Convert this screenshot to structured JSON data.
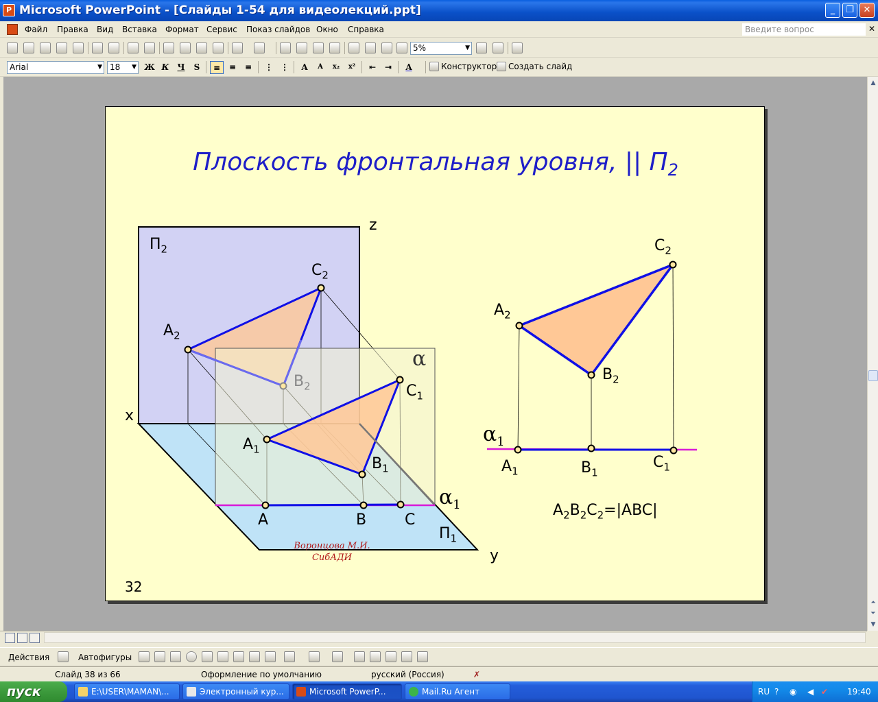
{
  "window": {
    "title": "Microsoft PowerPoint - [Слайды 1-54 для видеолекций.ppt]"
  },
  "menu": {
    "items": [
      "Файл",
      "Правка",
      "Вид",
      "Вставка",
      "Формат",
      "Сервис",
      "Показ слайдов",
      "Окно",
      "Справка"
    ],
    "help_placeholder": "Введите вопрос"
  },
  "toolbar": {
    "zoom": "5%",
    "font_name": "Arial",
    "font_size": "18",
    "designer": "Конструктор",
    "new_slide": "Создать слайд"
  },
  "slide": {
    "title": "Плоскость фронтальная уровня, || П",
    "title_sub": "2",
    "number": "32",
    "author_line1": "Воронцова М.И.",
    "author_line2": "СибАДИ",
    "labels": {
      "z": "z",
      "x": "x",
      "y": "y",
      "P2": "П",
      "P2_sub": "2",
      "P1": "П",
      "P1_sub": "1",
      "alpha": "α",
      "alpha1": "α",
      "alpha1_sub": "1",
      "A2": "A",
      "B2": "B",
      "C2": "C",
      "A1": "A",
      "B1": "B",
      "C1": "C",
      "A": "A",
      "B": "B",
      "C": "C",
      "sub1": "1",
      "sub2": "2",
      "r_A2": "A",
      "r_B2": "B",
      "r_C2": "C",
      "r_A1": "A",
      "r_B1": "B",
      "r_C1": "C",
      "r_alpha1": "α",
      "formula_A": "A",
      "formula_B": "B",
      "formula_C": "C",
      "formula_rest": "=|ABC|"
    },
    "colors": {
      "background": "#ffffcc",
      "title": "#1e1ec8",
      "edge": "#1010e6",
      "fill": "#ffc896",
      "trace": "#d81ad8",
      "plane_front": "#d2d2f4",
      "plane_horizontal": "#bfe3f7"
    }
  },
  "drawbar": {
    "actions": "Действия",
    "autoshapes": "Автофигуры"
  },
  "status": {
    "slide": "Слайд 38 из 66",
    "design": "Оформление по умолчанию",
    "language": "русский (Россия)"
  },
  "taskbar": {
    "start": "пуск",
    "tasks": [
      "E:\\USER\\MAMAN\\...",
      "Электронный кур...",
      "Microsoft PowerP...",
      "Mail.Ru Агент"
    ],
    "lang": "RU",
    "time": "19:40"
  }
}
